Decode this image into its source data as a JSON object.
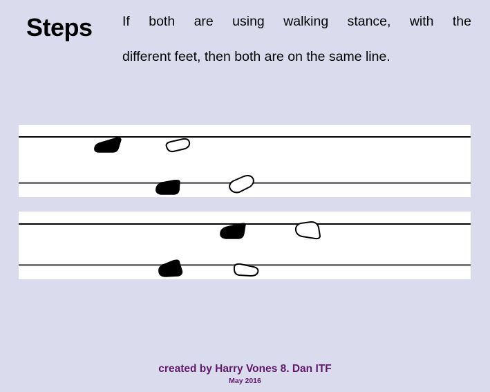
{
  "slide": {
    "background_color": "#dadbed",
    "title": "Steps",
    "body_line_1": "If both are using walking stance, with the",
    "body_line_2": "different feet, then both are on the same line."
  },
  "diagram": {
    "panel_background": "#ffffff",
    "line_color_front": "#000000",
    "line_color_back": "#7a7a7a",
    "filled_foot_color": "#000000",
    "outline_foot_color": "#ffffff",
    "panels": [
      {
        "name": "panel-1",
        "lines": [
          {
            "name": "front-line",
            "style": "black"
          },
          {
            "name": "back-line",
            "style": "gray"
          }
        ],
        "feet": [
          {
            "name": "left-partner-front-foot",
            "fill": "filled"
          },
          {
            "name": "right-partner-front-foot",
            "fill": "outline"
          },
          {
            "name": "left-partner-back-foot",
            "fill": "filled"
          },
          {
            "name": "right-partner-back-foot",
            "fill": "outline"
          }
        ]
      },
      {
        "name": "panel-2",
        "lines": [
          {
            "name": "front-line",
            "style": "black"
          },
          {
            "name": "back-line",
            "style": "gray"
          }
        ],
        "feet": [
          {
            "name": "left-partner-front-foot",
            "fill": "filled"
          },
          {
            "name": "right-partner-front-foot",
            "fill": "outline"
          },
          {
            "name": "left-partner-back-foot",
            "fill": "filled"
          },
          {
            "name": "right-partner-back-foot",
            "fill": "outline"
          }
        ]
      }
    ]
  },
  "footer": {
    "credit": "created by Harry Vones 8. Dan ITF",
    "date": "May 2016",
    "color": "#5f1a6b"
  }
}
